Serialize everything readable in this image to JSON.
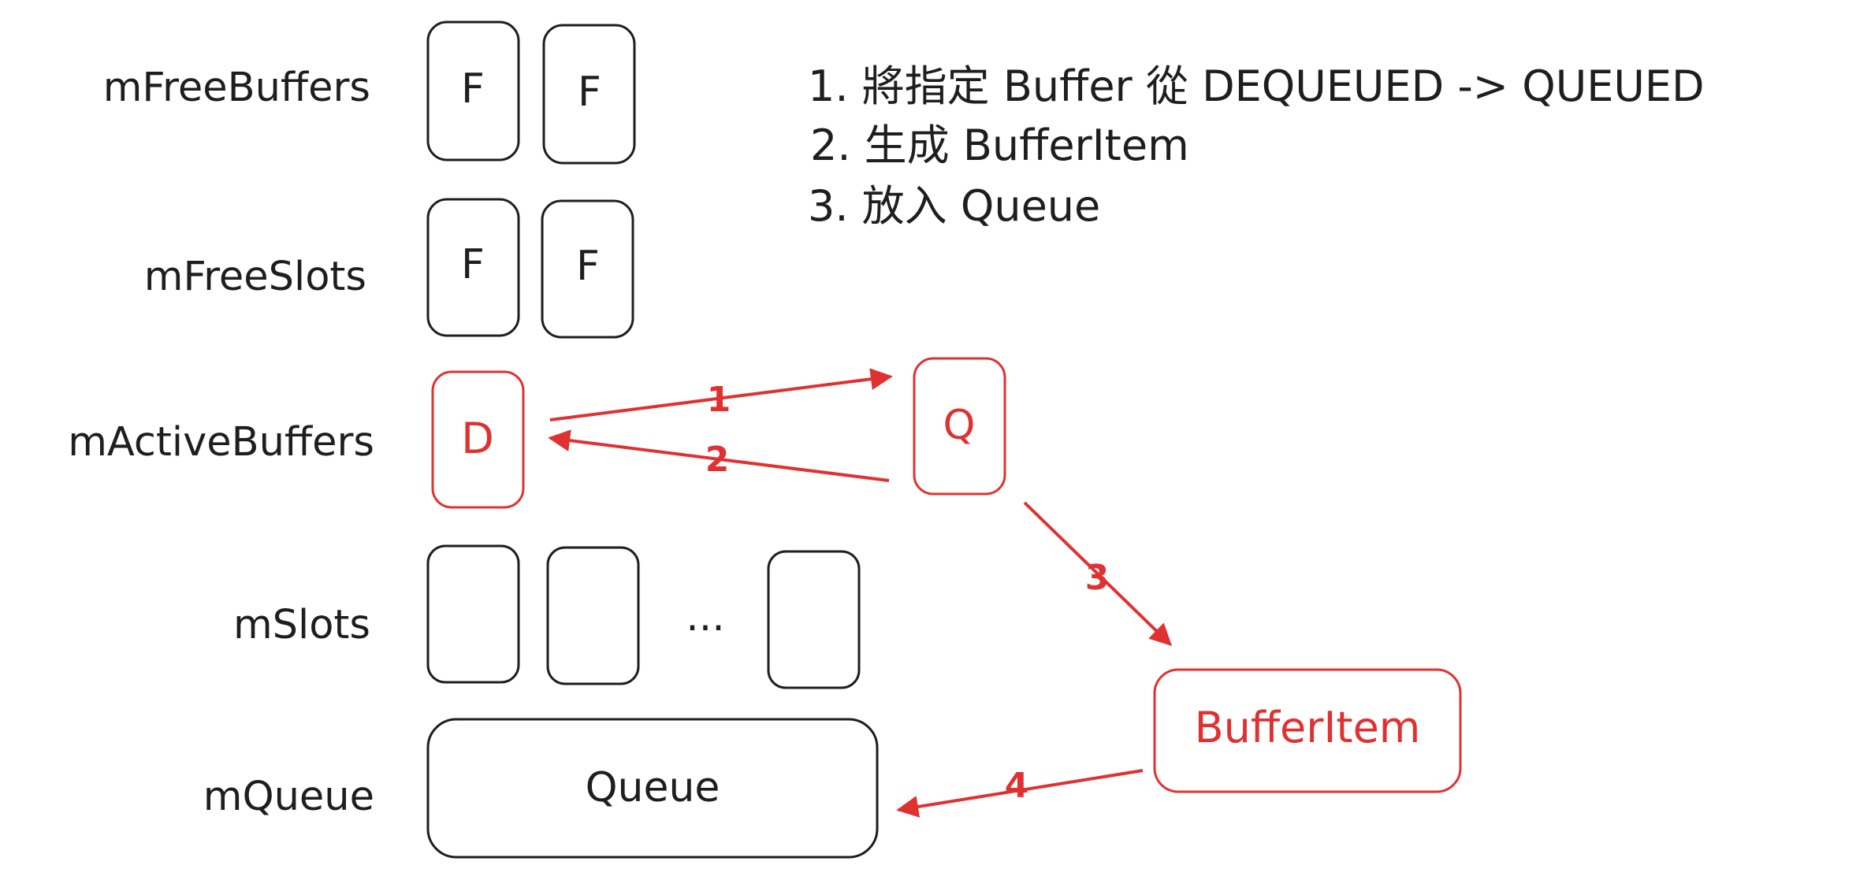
{
  "colors": {
    "ink": "#1e1e1e",
    "accent": "#e03131"
  },
  "labels": {
    "free_buffers": "mFreeBuffers",
    "free_slots": "mFreeSlots",
    "active_buffers": "mActiveBuffers",
    "slots": "mSlots",
    "queue": "mQueue"
  },
  "boxes": {
    "free_buffer_1": "F",
    "free_buffer_2": "F",
    "free_slot_1": "F",
    "free_slot_2": "F",
    "active_buffer": "D",
    "queued_buffer": "Q",
    "slots_ellipsis": "...",
    "queue": "Queue",
    "buffer_item": "BufferItem"
  },
  "steps": [
    "1. 將指定 Buffer 從 DEQUEUED -> QUEUED",
    "2. 生成 BufferItem",
    "3. 放入 Queue"
  ],
  "arrows": {
    "arrow_1": "1",
    "arrow_2": "2",
    "arrow_3": "3",
    "arrow_4": "4"
  }
}
